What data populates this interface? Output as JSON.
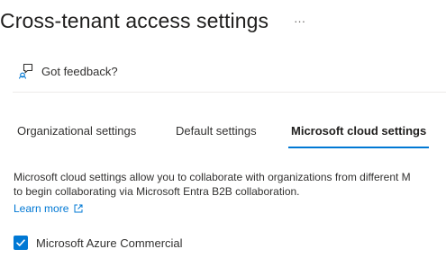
{
  "header": {
    "title": "Cross-tenant access settings",
    "more_label": "···"
  },
  "feedback": {
    "label": "Got feedback?",
    "icon": "feedback-icon"
  },
  "tabs": [
    {
      "label": "Organizational settings",
      "selected": false
    },
    {
      "label": "Default settings",
      "selected": false
    },
    {
      "label": "Microsoft cloud settings",
      "selected": true
    }
  ],
  "content": {
    "description_line1": "Microsoft cloud settings allow you to collaborate with organizations from different M",
    "description_line2": "to begin collaborating via Microsoft Entra B2B collaboration.",
    "learn_more": "Learn more",
    "learn_more_icon": "external-link-icon"
  },
  "clouds": [
    {
      "label": "Microsoft Azure Commercial",
      "checked": true
    }
  ],
  "colors": {
    "accent": "#0078d4",
    "text": "#323130",
    "divider": "#edebe9"
  }
}
